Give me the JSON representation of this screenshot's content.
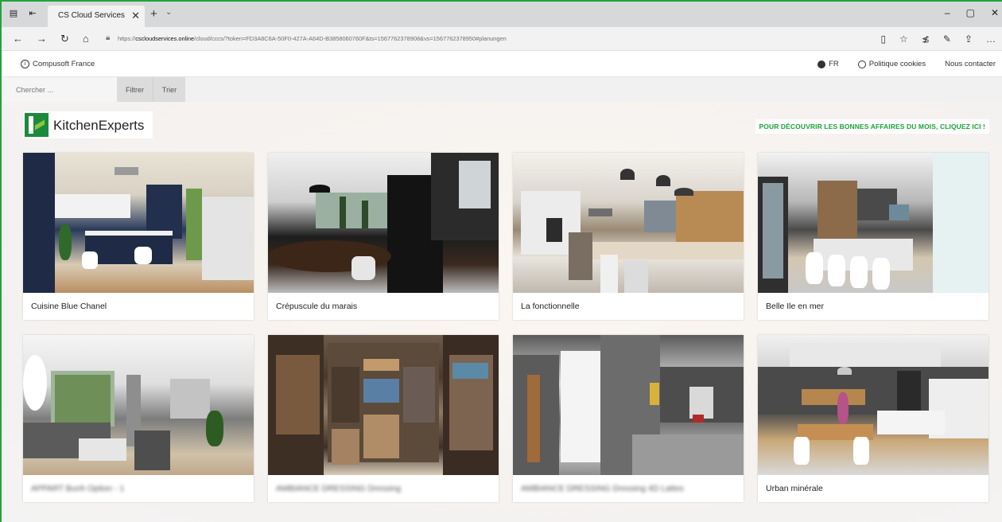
{
  "browser": {
    "tab_title": "CS Cloud Services",
    "url_prefix": "https://",
    "url_host": "cscloudservices.online",
    "url_rest": "/cloud/cccs/?token=FD3A8C6A-50F0-427A-A64D-B3858060760F&ts=1567762378908&vs=1567762378950#planungen"
  },
  "site": {
    "company": "Compusoft France",
    "lang": "FR",
    "cookies": "Politique cookies",
    "contact": "Nous contacter"
  },
  "search": {
    "placeholder": "Chercher ...",
    "filter_label": "Filtrer",
    "sort_label": "Trier"
  },
  "brand": {
    "logo_text": "KitchenExperts",
    "promo_text": "POUR DÉCOUVRIR LES BONNES AFFAIRES DU MOIS, CLIQUEZ ICI !",
    "accent": "#1aa33a"
  },
  "cards": [
    {
      "title": "Cuisine Blue Chanel"
    },
    {
      "title": "Crépuscule du marais"
    },
    {
      "title": "La fonctionnelle"
    },
    {
      "title": "Belle Ile en mer"
    },
    {
      "title": "APPART Bunh Option - 1"
    },
    {
      "title": "AMBIANCE DRESSING Dressing"
    },
    {
      "title": "AMBIANCE DRESSING Dressing 4D Lattes"
    },
    {
      "title": "Urban minérale"
    }
  ]
}
